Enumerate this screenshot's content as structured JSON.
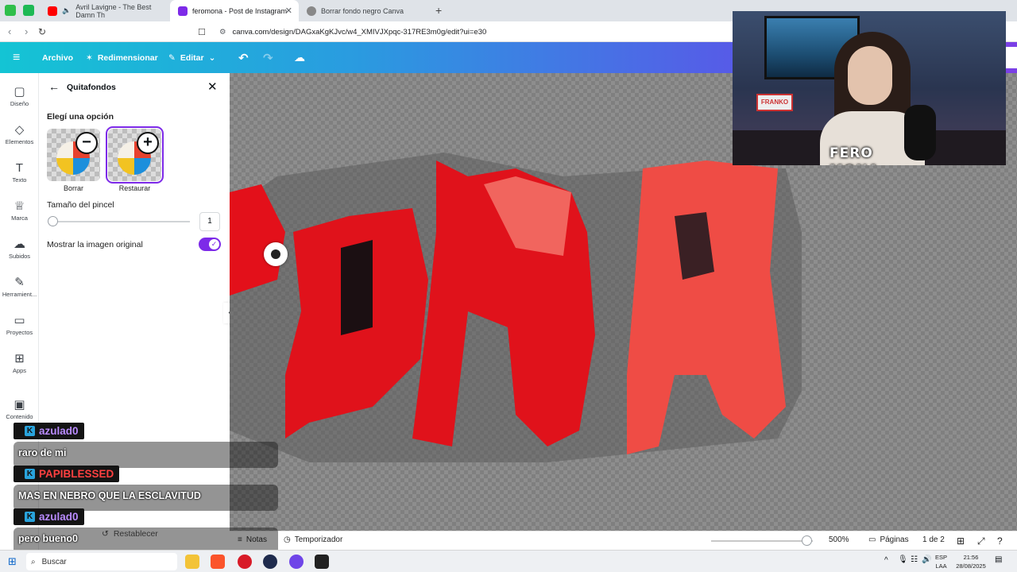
{
  "browser": {
    "tabs": [
      {
        "title": "Avril Lavigne - The Best Damn Th"
      },
      {
        "title": "feromona - Post de Instagram"
      },
      {
        "title": "Borrar fondo negro Canva"
      }
    ],
    "url": "canva.com/design/DAGxaKgKJvc/w4_XMIVJXpqc-317RE3m0g/edit?ui=e30"
  },
  "toolbar": {
    "file": "Archivo",
    "resize": "Redimensionar",
    "edit": "Editar"
  },
  "rail": [
    {
      "label": "Diseño",
      "icon": "layout-icon"
    },
    {
      "label": "Elementos",
      "icon": "shapes-icon"
    },
    {
      "label": "Texto",
      "icon": "text-icon"
    },
    {
      "label": "Marca",
      "icon": "brand-icon"
    },
    {
      "label": "Subidos",
      "icon": "upload-icon"
    },
    {
      "label": "Herramient...",
      "icon": "tools-icon"
    },
    {
      "label": "Proyectos",
      "icon": "folder-icon"
    },
    {
      "label": "Apps",
      "icon": "apps-icon"
    },
    {
      "label": "Contenido",
      "icon": "content-icon"
    }
  ],
  "panel": {
    "title": "Quitafondos",
    "section": "Elegí una opción",
    "options": [
      {
        "label": "Borrar",
        "symbol": "−"
      },
      {
        "label": "Restaurar",
        "symbol": "+"
      }
    ],
    "brush_label": "Tamaño del pincel",
    "brush_value": "1",
    "original_label": "Mostrar la imagen original",
    "original_on": true,
    "reset": "Restablecer"
  },
  "chat": [
    {
      "user": "azulad0",
      "color": "#b98bff",
      "message": "raro de mi"
    },
    {
      "user": "PAPIBLESSED",
      "color": "#ff4040",
      "message": "MAS EN NEBRO QUE LA ESCLAVITUD"
    },
    {
      "user": "azulad0",
      "color": "#b98bff",
      "message": "pero bueno0"
    }
  ],
  "webcam": {
    "logo": "FERO\nMONA",
    "sign": "FRANKO"
  },
  "statusbar": {
    "notes": "Notas",
    "timer": "Temporizador",
    "zoom": "500%",
    "zoom_fraction": 0.94,
    "pages": "Páginas",
    "page_count": "1 de 2"
  },
  "taskbar": {
    "search": "Buscar",
    "lang": "ESP",
    "region": "LAA",
    "time": "21:56",
    "date": "28/08/2025"
  },
  "colors": {
    "canva_purple": "#7d2ae8",
    "toolbar_start": "#14c4d4",
    "toolbar_end": "#7b3fe6"
  }
}
